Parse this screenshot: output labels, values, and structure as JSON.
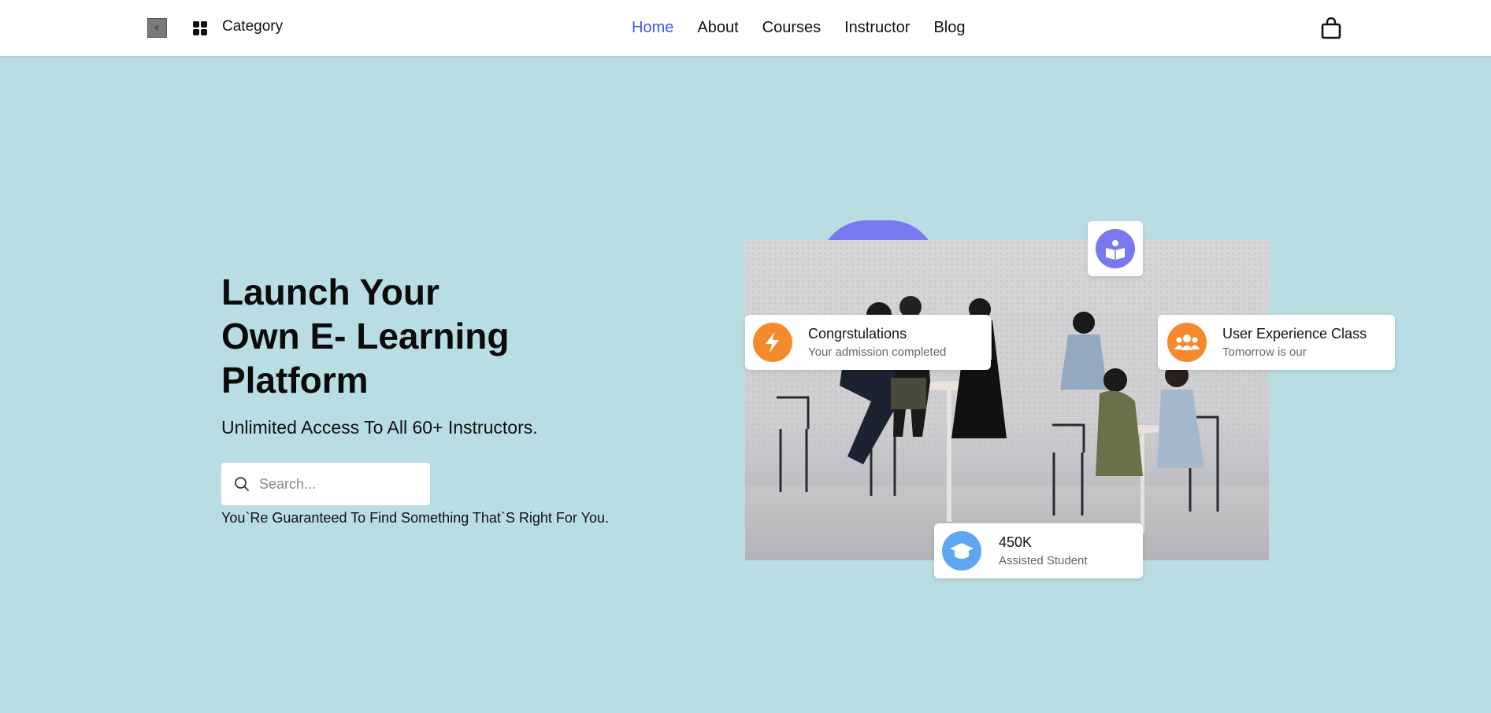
{
  "header": {
    "logo_text": "e",
    "category_label": "Category",
    "nav": [
      {
        "label": "Home",
        "active": true
      },
      {
        "label": "About",
        "active": false
      },
      {
        "label": "Courses",
        "active": false
      },
      {
        "label": "Instructor",
        "active": false
      },
      {
        "label": "Blog",
        "active": false
      }
    ],
    "cart_icon": "shopping-bag-icon"
  },
  "hero": {
    "title_line1": "Launch Your",
    "title_line2": "Own E- Learning",
    "title_line3": "Platform",
    "subtitle": "Unlimited Access To All 60+ Instructors.",
    "search_placeholder": "Search...",
    "note": "You`Re Guaranteed To Find Something That`S Right For You."
  },
  "cards": {
    "congrats": {
      "title": "Congrstulations",
      "subtitle": "Your admission completed",
      "icon": "lightning-icon",
      "color": "#f58a2c"
    },
    "ux_class": {
      "title": "User Experience Class",
      "subtitle": "Tomorrow is our",
      "icon": "users-icon",
      "color": "#f58a2c"
    },
    "students": {
      "title": "450K",
      "subtitle": "Assisted Student",
      "icon": "graduation-cap-icon",
      "color": "#5ea5f3"
    },
    "book": {
      "icon": "reading-book-icon",
      "color": "#7a78ee"
    }
  },
  "colors": {
    "background": "#b8dde2",
    "nav_active": "#3c5be0",
    "accent_purple": "#7a78ee"
  }
}
